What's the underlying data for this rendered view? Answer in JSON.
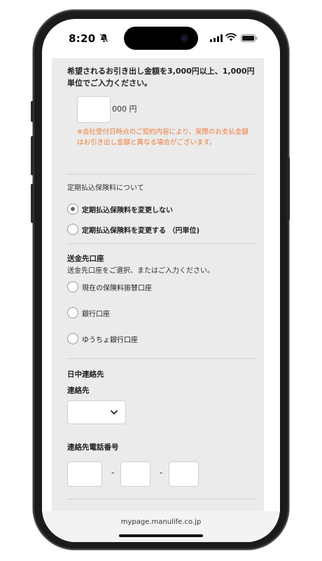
{
  "status_bar": {
    "time": "8:20",
    "icons": [
      "bell-slash-icon",
      "cellular-signal-icon",
      "wifi-icon",
      "battery-icon"
    ]
  },
  "form": {
    "withdraw_instruction": "希望されるお引き出し金額を3,000円以上、1,000円単位でご入力ください。",
    "amount_input": {
      "value": "",
      "suffix": "000 円"
    },
    "amount_note": "※会社受付日時点のご契約内容により、実際のお支払金額はお引き出し金額と異なる場合がございます。",
    "premium_section": {
      "label": "定期払込保険料について",
      "options": [
        {
          "label": "定期払込保険料を変更しない",
          "selected": true
        },
        {
          "label": "定期払込保険料を変更する （円単位)",
          "selected": false
        }
      ]
    },
    "remit_section": {
      "title": "送金先口座",
      "subtitle": "送金先口座をご選択、またはご入力ください。",
      "options": [
        {
          "label": "現在の保険料振替口座",
          "selected": false
        },
        {
          "label": "銀行口座",
          "selected": false
        },
        {
          "label": "ゆうちょ銀行口座",
          "selected": false
        }
      ]
    },
    "contact_section": {
      "title": "日中連絡先",
      "contact_label": "連絡先",
      "contact_select_value": "",
      "phone_label": "連絡先電話番号",
      "phone_parts": [
        "",
        "",
        ""
      ],
      "separator": "-"
    }
  },
  "browser": {
    "url": "mypage.manulife.co.jp"
  },
  "colors": {
    "note_orange": "#ee7d3a",
    "panel_bg": "#ebebeb"
  }
}
